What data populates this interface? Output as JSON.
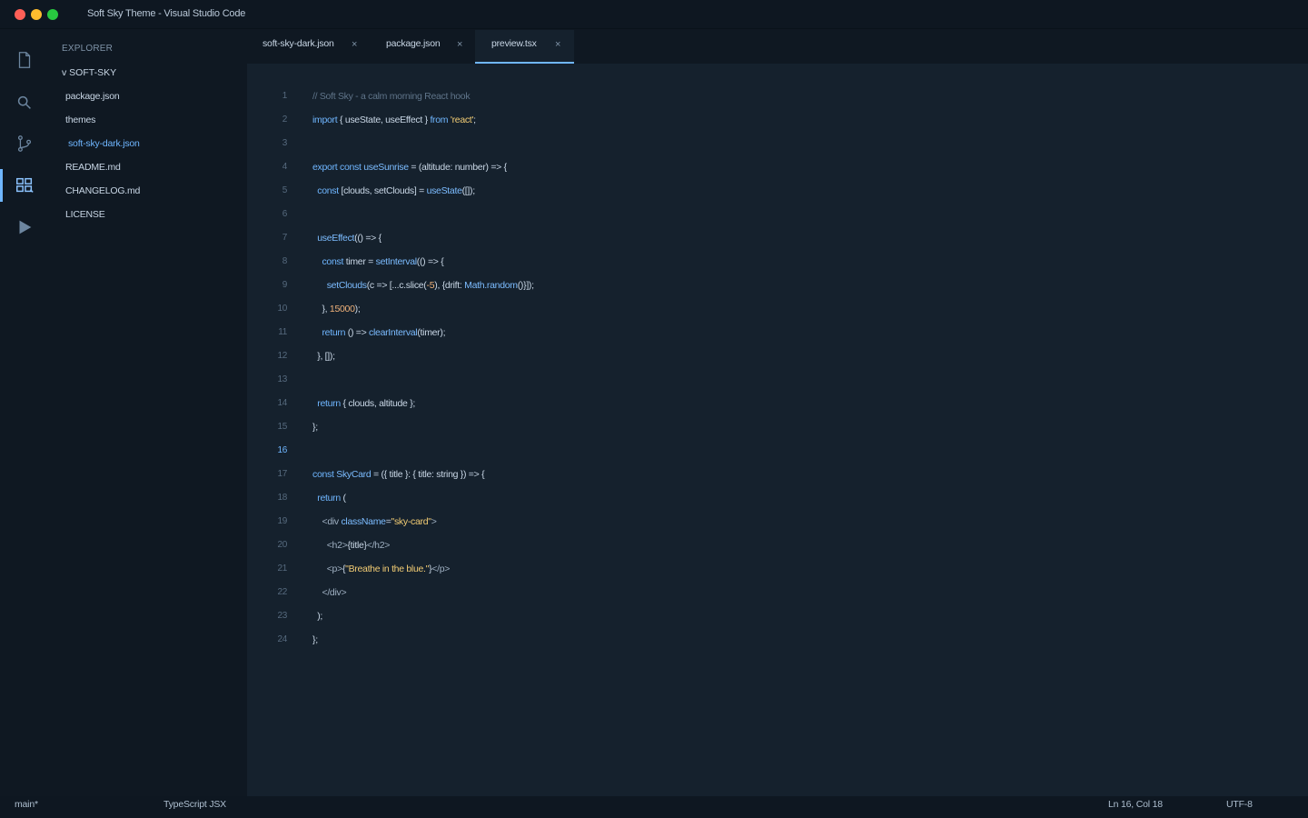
{
  "window": {
    "title": "Soft Sky Theme - Visual Studio Code"
  },
  "activitybar": {
    "items": [
      {
        "name": "explorer",
        "icon": "files-icon"
      },
      {
        "name": "search",
        "icon": "search-icon"
      },
      {
        "name": "source-control",
        "icon": "source-control-icon"
      },
      {
        "name": "extensions",
        "icon": "extensions-icon",
        "active": true
      },
      {
        "name": "run",
        "icon": "run-icon"
      }
    ]
  },
  "sidebar": {
    "title": "EXPLORER",
    "root": "v SOFT-SKY",
    "files": [
      {
        "label": "package.json"
      },
      {
        "label": "themes"
      },
      {
        "label": "soft-sky-dark.json",
        "active": true
      },
      {
        "label": "README.md"
      },
      {
        "label": "CHANGELOG.md"
      },
      {
        "label": "LICENSE"
      }
    ]
  },
  "tabs": [
    {
      "label": "soft-sky-dark.json",
      "close": "×"
    },
    {
      "label": "package.json",
      "close": "×"
    },
    {
      "label": "preview.tsx",
      "close": "×",
      "active": true
    }
  ],
  "editor": {
    "current_line": 16,
    "lines": [
      {
        "n": "1",
        "tokens": [
          [
            "c",
            "// Soft Sky - a calm morning React hook"
          ]
        ]
      },
      {
        "n": "2",
        "tokens": [
          [
            "k",
            "import"
          ],
          [
            "p",
            " { useState, useEffect } "
          ],
          [
            "k",
            "from"
          ],
          [
            "p",
            " "
          ],
          [
            "s",
            "'react'"
          ],
          [
            "p",
            ";"
          ]
        ]
      },
      {
        "n": "3",
        "tokens": []
      },
      {
        "n": "4",
        "tokens": [
          [
            "k",
            "export const"
          ],
          [
            "p",
            " "
          ],
          [
            "f",
            "useSunrise"
          ],
          [
            "p",
            " = (altitude: number) => {"
          ]
        ]
      },
      {
        "n": "5",
        "tokens": [
          [
            "p",
            "  "
          ],
          [
            "k",
            "const"
          ],
          [
            "p",
            " [clouds, setClouds] = "
          ],
          [
            "f",
            "useState"
          ],
          [
            "p",
            "([]);"
          ]
        ]
      },
      {
        "n": "6",
        "tokens": []
      },
      {
        "n": "7",
        "tokens": [
          [
            "p",
            "  "
          ],
          [
            "f",
            "useEffect"
          ],
          [
            "p",
            "(() => {"
          ]
        ]
      },
      {
        "n": "8",
        "tokens": [
          [
            "p",
            "    "
          ],
          [
            "k",
            "const"
          ],
          [
            "p",
            " timer = "
          ],
          [
            "f",
            "setInterval"
          ],
          [
            "p",
            "(() => {"
          ]
        ]
      },
      {
        "n": "9",
        "tokens": [
          [
            "p",
            "      "
          ],
          [
            "f",
            "setClouds"
          ],
          [
            "p",
            "(c => [...c.slice("
          ],
          [
            "n",
            "-5"
          ],
          [
            "p",
            "), {drift: "
          ],
          [
            "f",
            "Math.random"
          ],
          [
            "p",
            "()}]);"
          ]
        ]
      },
      {
        "n": "10",
        "tokens": [
          [
            "p",
            "    }, "
          ],
          [
            "n",
            "15000"
          ],
          [
            "p",
            ");"
          ]
        ]
      },
      {
        "n": "11",
        "tokens": [
          [
            "p",
            "    "
          ],
          [
            "k",
            "return"
          ],
          [
            "p",
            " () => "
          ],
          [
            "f",
            "clearInterval"
          ],
          [
            "p",
            "(timer);"
          ]
        ]
      },
      {
        "n": "12",
        "tokens": [
          [
            "p",
            "  }, []);"
          ]
        ]
      },
      {
        "n": "13",
        "tokens": []
      },
      {
        "n": "14",
        "tokens": [
          [
            "p",
            "  "
          ],
          [
            "k",
            "return"
          ],
          [
            "p",
            " { clouds, altitude };"
          ]
        ]
      },
      {
        "n": "15",
        "tokens": [
          [
            "p",
            "};"
          ]
        ]
      },
      {
        "n": "16",
        "tokens": []
      },
      {
        "n": "17",
        "tokens": [
          [
            "k",
            "const"
          ],
          [
            "p",
            " "
          ],
          [
            "f",
            "SkyCard"
          ],
          [
            "p",
            " = ({ title }: { title: string }) => {"
          ]
        ]
      },
      {
        "n": "18",
        "tokens": [
          [
            "p",
            "  "
          ],
          [
            "k",
            "return"
          ],
          [
            "p",
            " ("
          ]
        ]
      },
      {
        "n": "19",
        "tokens": [
          [
            "p",
            "    "
          ],
          [
            "t",
            "<div"
          ],
          [
            "p",
            " "
          ],
          [
            "f",
            "className"
          ],
          [
            "p",
            "="
          ],
          [
            "s",
            "\"sky-card\""
          ],
          [
            "t",
            ">"
          ]
        ]
      },
      {
        "n": "20",
        "tokens": [
          [
            "p",
            "      "
          ],
          [
            "t",
            "<h2>"
          ],
          [
            "p",
            "{title}"
          ],
          [
            "t",
            "</h2>"
          ]
        ]
      },
      {
        "n": "21",
        "tokens": [
          [
            "p",
            "      "
          ],
          [
            "t",
            "<p>"
          ],
          [
            "p",
            "{"
          ],
          [
            "s",
            "\"Breathe in the blue.\""
          ],
          [
            "p",
            "}"
          ],
          [
            "t",
            "</p>"
          ]
        ]
      },
      {
        "n": "22",
        "tokens": [
          [
            "p",
            "    "
          ],
          [
            "t",
            "</div>"
          ]
        ]
      },
      {
        "n": "23",
        "tokens": [
          [
            "p",
            "  );"
          ]
        ]
      },
      {
        "n": "24",
        "tokens": [
          [
            "p",
            "};"
          ]
        ]
      }
    ]
  },
  "statusbar": {
    "branch": "main*",
    "language": "TypeScript JSX",
    "position": "Ln 16, Col 18",
    "encoding": "UTF-8"
  },
  "colors": {
    "accent": "#6fb6ff",
    "background": "#0f1822",
    "editor_background": "#15212d"
  }
}
